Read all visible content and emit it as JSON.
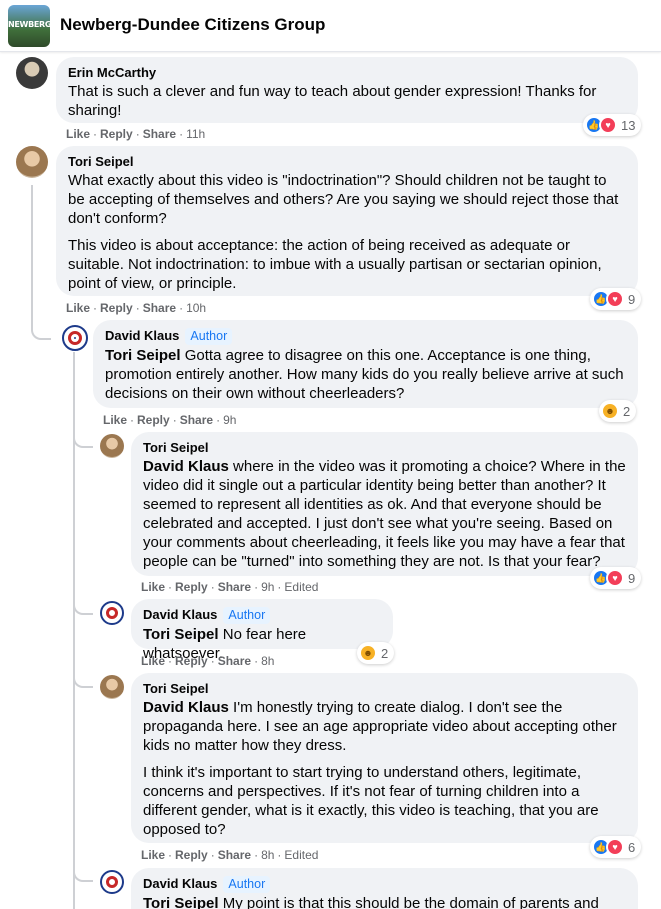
{
  "group": {
    "title": "Newberg-Dundee Citizens Group",
    "avatar_text": "NEWBERG"
  },
  "comments": [
    {
      "author": "Erin McCarthy",
      "paragraphs": [
        "That is such a clever and fun way to teach about gender expression! Thanks for sharing!"
      ],
      "actions": {
        "like": "Like",
        "reply": "Reply",
        "share": "Share",
        "time": "11h"
      },
      "reaction_count": "13",
      "reaction_icons": [
        "like-icon",
        "love-icon"
      ]
    },
    {
      "author": "Tori Seipel",
      "paragraphs": [
        "What exactly about this video is \"indoctrination\"? Should children not be taught to be accepting of themselves and others? Are you saying we should reject those that don't conform?",
        "This video is about acceptance: the action of being received as adequate or suitable. Not indoctrination: to imbue with a usually partisan or sectarian opinion, point of view, or principle."
      ],
      "actions": {
        "like": "Like",
        "reply": "Reply",
        "share": "Share",
        "time": "10h"
      },
      "reaction_count": "9",
      "reaction_icons": [
        "like-icon",
        "love-icon"
      ]
    },
    {
      "author": "David Klaus",
      "badge": "Author",
      "mention": "Tori Seipel",
      "text": "Gotta agree to disagree on this one. Acceptance is one thing, promotion entirely another. How many kids do you really believe arrive at such decisions on their own without cheerleaders?",
      "actions": {
        "like": "Like",
        "reply": "Reply",
        "share": "Share",
        "time": "9h"
      },
      "reaction_count": "2",
      "reaction_icons": [
        "haha-icon"
      ]
    },
    {
      "author": "Tori Seipel",
      "mention": "David Klaus",
      "text": "where in the video was it promoting a choice? Where in the video did it single out a particular identity being better than another? It seemed to represent all identities as ok. And that everyone should be celebrated and accepted. I just don't see what you're seeing. Based on your comments about cheerleading, it feels like you may have a fear that people can be \"turned\" into something they are not. Is that your fear?",
      "actions": {
        "like": "Like",
        "reply": "Reply",
        "share": "Share",
        "time": "9h",
        "edited": "Edited"
      },
      "reaction_count": "9",
      "reaction_icons": [
        "like-icon",
        "love-icon"
      ]
    },
    {
      "author": "David Klaus",
      "badge": "Author",
      "mention": "Tori Seipel",
      "text": "No fear here whatsoever.",
      "actions": {
        "like": "Like",
        "reply": "Reply",
        "share": "Share",
        "time": "8h"
      },
      "reaction_count": "2",
      "reaction_icons": [
        "haha-icon"
      ]
    },
    {
      "author": "Tori Seipel",
      "mention": "David Klaus",
      "text": "I'm honestly trying to create dialog. I don't see the propaganda here. I see an age appropriate video about accepting other kids no matter how they dress.",
      "paragraph2": "I think it's important to start trying to understand others, legitimate, concerns and perspectives. If it's not fear of turning children into a different gender, what is it exactly, this video is teaching, that you are opposed to?",
      "actions": {
        "like": "Like",
        "reply": "Reply",
        "share": "Share",
        "time": "8h",
        "edited": "Edited"
      },
      "reaction_count": "6",
      "reaction_icons": [
        "like-icon",
        "love-icon"
      ]
    },
    {
      "author": "David Klaus",
      "badge": "Author",
      "mention": "Tori Seipel",
      "text": "My point is that this should be the domain of parents and"
    }
  ],
  "colors": {
    "link_blue": "#1877f2",
    "bubble_bg": "#f0f2f5",
    "meta_gray": "#65676b",
    "love_red": "#f33e58",
    "haha_yellow": "#f7b125"
  }
}
